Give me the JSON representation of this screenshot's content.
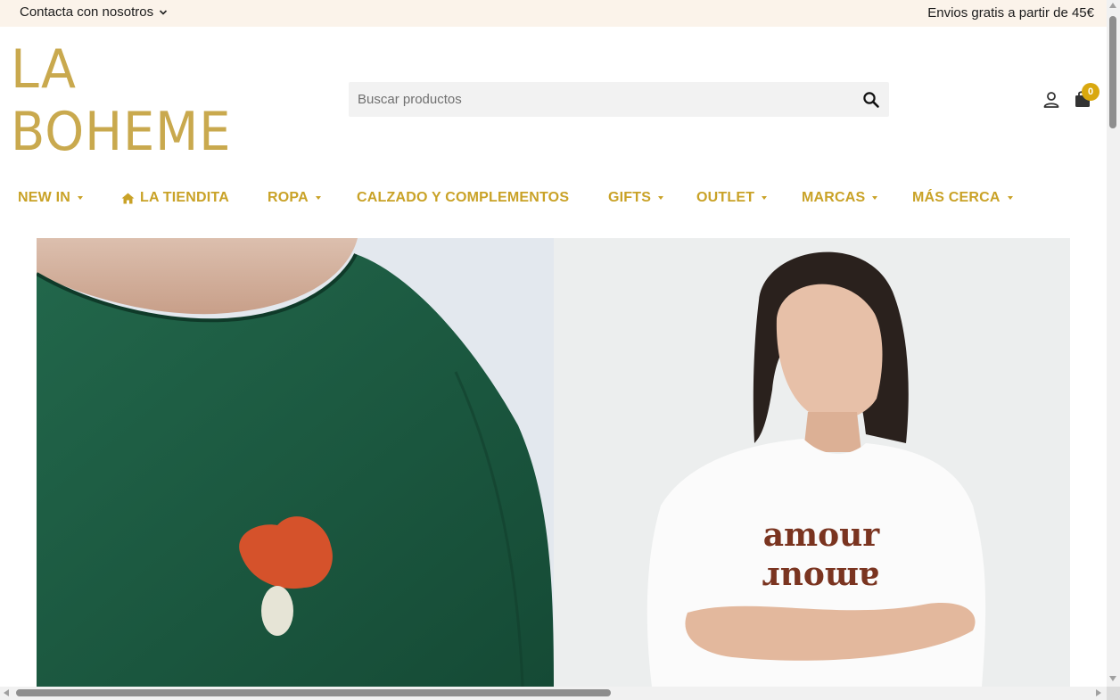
{
  "topbar": {
    "contact_label": "Contacta con nosotros",
    "shipping_text": "Envios gratis a partir de 45€"
  },
  "logo": {
    "line1": "LA",
    "line2": "BOHEME",
    "color": "#c9a94e"
  },
  "search": {
    "placeholder": "Buscar productos",
    "value": ""
  },
  "cart": {
    "count": "0",
    "badge_color": "#d9a80f"
  },
  "icons": [
    "chevron-down-icon",
    "search-icon",
    "user-icon",
    "shopping-bag-icon",
    "home-icon",
    "caret-down-icon"
  ],
  "nav": {
    "color": "#c9a227",
    "items": [
      {
        "label": "NEW IN",
        "dropdown": true
      },
      {
        "label": "LA TIENDITA",
        "dropdown": false,
        "icon": "home-icon"
      },
      {
        "label": "ROPA",
        "dropdown": true
      },
      {
        "label": "CALZADO Y COMPLEMENTOS",
        "dropdown": false
      },
      {
        "label": "GIFTS",
        "dropdown": true
      },
      {
        "label": "OUTLET",
        "dropdown": true
      },
      {
        "label": "MARCAS",
        "dropdown": true
      },
      {
        "label": "MÁS CERCA",
        "dropdown": true
      }
    ]
  },
  "hero": {
    "left_shirt_color": "#1e5b43",
    "right_print_line1": "amour",
    "right_print_line2": "amour"
  }
}
